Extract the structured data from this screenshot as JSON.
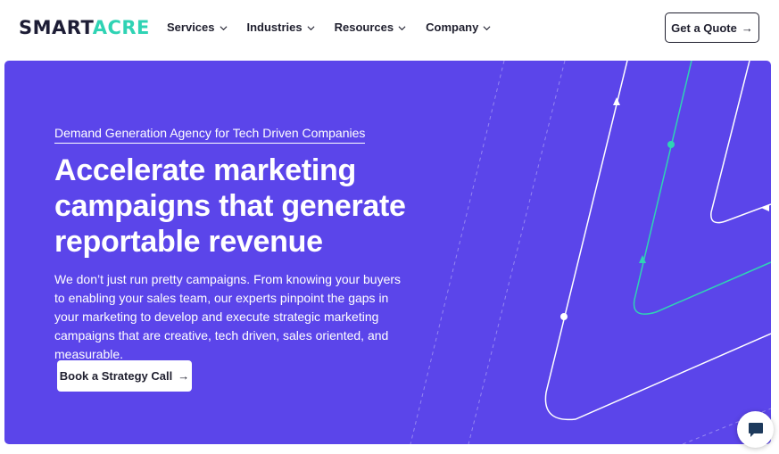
{
  "brand": {
    "logo_part1": "SMART",
    "logo_part2": "ACRE",
    "accent": "#2fd3b4",
    "hero_bg": "#5b45ea"
  },
  "nav": {
    "items": [
      {
        "label": "Services"
      },
      {
        "label": "Industries"
      },
      {
        "label": "Resources"
      },
      {
        "label": "Company"
      }
    ],
    "quote_button": "Get a Quote",
    "arrow_icon": "→"
  },
  "hero": {
    "eyebrow": "Demand Generation Agency for Tech Driven Companies",
    "headline": "Accelerate marketing campaigns that generate reportable revenue",
    "body": "We don’t just run pretty campaigns. From knowing your buyers to enabling your sales team, our experts pinpoint the gaps in your marketing to develop and execute strategic marketing campaigns that are creative, tech driven, sales oriented, and measurable.",
    "cta": "Book a Strategy Call"
  },
  "chat": {
    "icon": "chat-icon"
  }
}
